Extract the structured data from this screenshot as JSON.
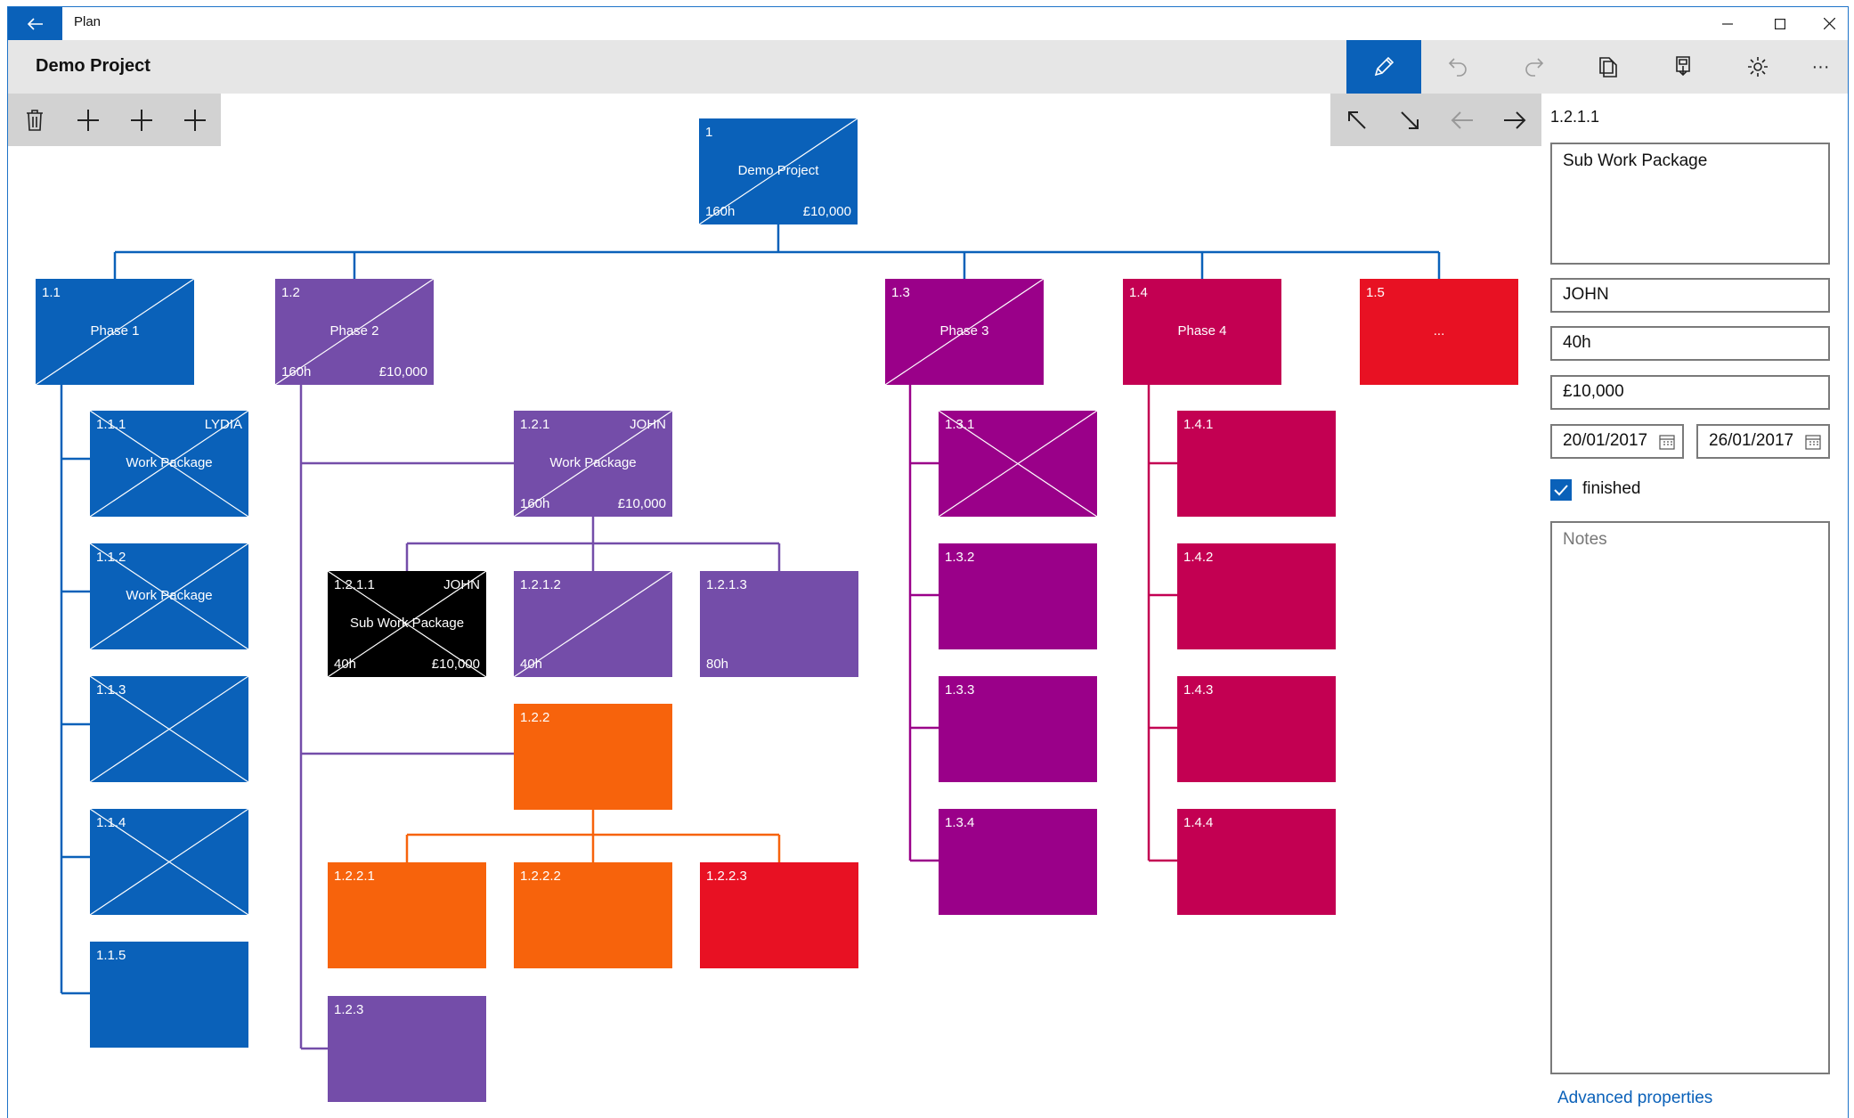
{
  "window": {
    "title": "Plan"
  },
  "header": {
    "project_title": "Demo Project"
  },
  "colors": {
    "blue": "#0a61b9",
    "purple": "#744da9",
    "magenta": "#9a0089",
    "crimson": "#c30052",
    "red": "#e81123",
    "orange": "#f7630c",
    "black": "#000000"
  },
  "toolbar": {
    "items": [
      "pencil-icon",
      "undo-icon",
      "redo-icon",
      "copy-icon",
      "save-icon",
      "settings-icon",
      "more-icon"
    ],
    "more_label": "···"
  },
  "left_tools": [
    "delete-icon",
    "add-sibling-icon",
    "add-child-icon",
    "add-icon"
  ],
  "nav_tools": [
    "arrow-up-left-icon",
    "arrow-down-right-icon",
    "arrow-left-icon",
    "arrow-right-icon"
  ],
  "nodes": {
    "n1": {
      "id": "1",
      "name": "Demo Project",
      "owner": "",
      "hours": "160h",
      "cost": "£10,000",
      "color": "blue"
    },
    "n1_1": {
      "id": "1.1",
      "name": "Phase 1",
      "owner": "",
      "hours": "",
      "cost": "",
      "color": "blue"
    },
    "n1_2": {
      "id": "1.2",
      "name": "Phase 2",
      "owner": "",
      "hours": "160h",
      "cost": "£10,000",
      "color": "purple"
    },
    "n1_3": {
      "id": "1.3",
      "name": "Phase 3",
      "owner": "",
      "hours": "",
      "cost": "",
      "color": "magenta"
    },
    "n1_4": {
      "id": "1.4",
      "name": "Phase 4",
      "owner": "",
      "hours": "",
      "cost": "",
      "color": "crimson"
    },
    "n1_5": {
      "id": "1.5",
      "name": "...",
      "owner": "",
      "hours": "",
      "cost": "",
      "color": "red"
    },
    "n1_1_1": {
      "id": "1.1.1",
      "name": "Work Package",
      "owner": "LYDIA",
      "hours": "",
      "cost": "",
      "color": "blue"
    },
    "n1_1_2": {
      "id": "1.1.2",
      "name": "Work Package",
      "owner": "",
      "hours": "",
      "cost": "",
      "color": "blue"
    },
    "n1_1_3": {
      "id": "1.1.3",
      "name": "",
      "owner": "",
      "hours": "",
      "cost": "",
      "color": "blue"
    },
    "n1_1_4": {
      "id": "1.1.4",
      "name": "",
      "owner": "",
      "hours": "",
      "cost": "",
      "color": "blue"
    },
    "n1_1_5": {
      "id": "1.1.5",
      "name": "",
      "owner": "",
      "hours": "",
      "cost": "",
      "color": "blue"
    },
    "n1_2_1": {
      "id": "1.2.1",
      "name": "Work Package",
      "owner": "JOHN",
      "hours": "160h",
      "cost": "£10,000",
      "color": "purple"
    },
    "n1_2_1_1": {
      "id": "1.2.1.1",
      "name": "Sub Work Package",
      "owner": "JOHN",
      "hours": "40h",
      "cost": "£10,000",
      "color": "black"
    },
    "n1_2_1_2": {
      "id": "1.2.1.2",
      "name": "",
      "owner": "",
      "hours": "40h",
      "cost": "",
      "color": "purple"
    },
    "n1_2_1_3": {
      "id": "1.2.1.3",
      "name": "",
      "owner": "",
      "hours": "80h",
      "cost": "",
      "color": "purple"
    },
    "n1_2_2": {
      "id": "1.2.2",
      "name": "",
      "owner": "",
      "hours": "",
      "cost": "",
      "color": "orange"
    },
    "n1_2_2_1": {
      "id": "1.2.2.1",
      "name": "",
      "owner": "",
      "hours": "",
      "cost": "",
      "color": "orange"
    },
    "n1_2_2_2": {
      "id": "1.2.2.2",
      "name": "",
      "owner": "",
      "hours": "",
      "cost": "",
      "color": "orange"
    },
    "n1_2_2_3": {
      "id": "1.2.2.3",
      "name": "",
      "owner": "",
      "hours": "",
      "cost": "",
      "color": "red"
    },
    "n1_2_3": {
      "id": "1.2.3",
      "name": "",
      "owner": "",
      "hours": "",
      "cost": "",
      "color": "purple"
    },
    "n1_3_1": {
      "id": "1.3.1",
      "name": "",
      "owner": "",
      "hours": "",
      "cost": "",
      "color": "magenta"
    },
    "n1_3_2": {
      "id": "1.3.2",
      "name": "",
      "owner": "",
      "hours": "",
      "cost": "",
      "color": "magenta"
    },
    "n1_3_3": {
      "id": "1.3.3",
      "name": "",
      "owner": "",
      "hours": "",
      "cost": "",
      "color": "magenta"
    },
    "n1_3_4": {
      "id": "1.3.4",
      "name": "",
      "owner": "",
      "hours": "",
      "cost": "",
      "color": "magenta"
    },
    "n1_4_1": {
      "id": "1.4.1",
      "name": "",
      "owner": "",
      "hours": "",
      "cost": "",
      "color": "crimson"
    },
    "n1_4_2": {
      "id": "1.4.2",
      "name": "",
      "owner": "",
      "hours": "",
      "cost": "",
      "color": "crimson"
    },
    "n1_4_3": {
      "id": "1.4.3",
      "name": "",
      "owner": "",
      "hours": "",
      "cost": "",
      "color": "crimson"
    },
    "n1_4_4": {
      "id": "1.4.4",
      "name": "",
      "owner": "",
      "hours": "",
      "cost": "",
      "color": "crimson"
    }
  },
  "panel": {
    "selected_id": "1.2.1.1",
    "name_value": "Sub Work Package",
    "owner_value": "JOHN",
    "hours_value": "40h",
    "cost_value": "£10,000",
    "start_date": "20/01/2017",
    "end_date": "26/01/2017",
    "finished_label": "finished",
    "finished_checked": true,
    "notes_placeholder": "Notes",
    "advanced_link": "Advanced properties"
  }
}
